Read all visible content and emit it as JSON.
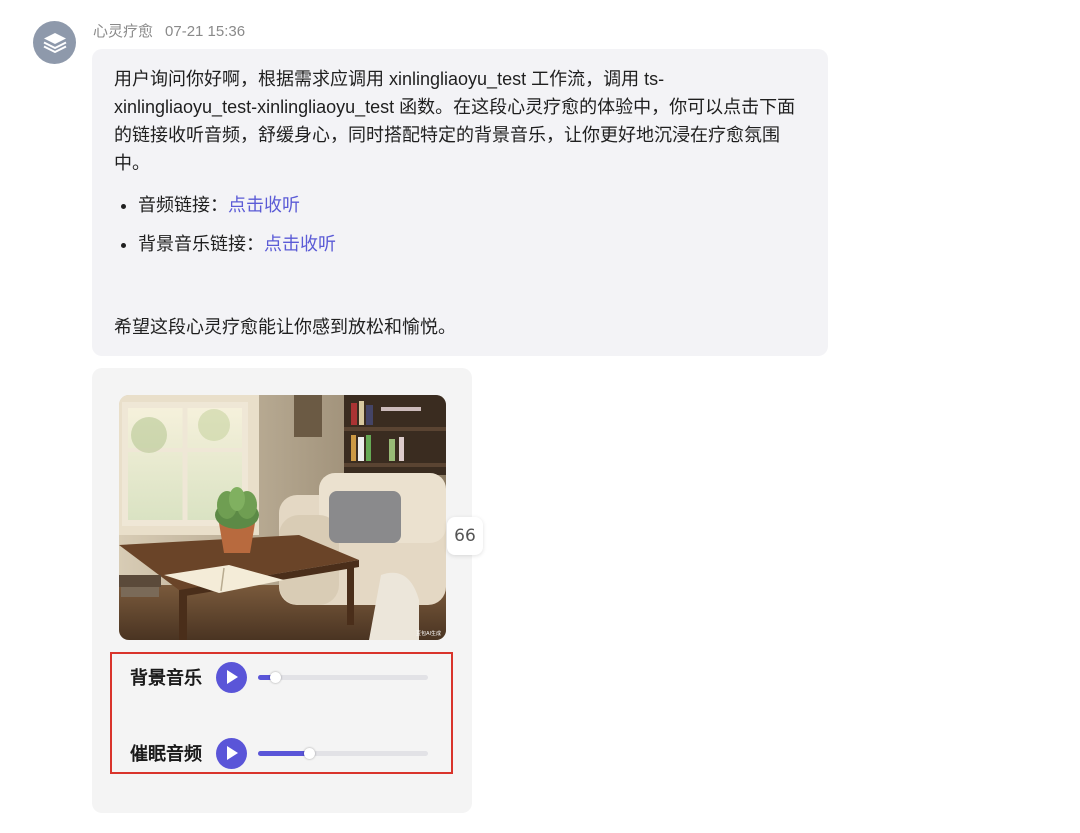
{
  "message": {
    "sender": "心灵疗愈",
    "timestamp": "07-21 15:36",
    "intro": "用户询问你好啊，根据需求应调用 xinlingliaoyu_test 工作流，调用 ts-xinlingliaoyu_test-xinlingliaoyu_test 函数。在这段心灵疗愈的体验中，你可以点击下面的链接收听音频，舒缓身心，同时搭配特定的背景音乐，让你更好地沉浸在疗愈氛围中。",
    "bullets": [
      {
        "label": "音频链接：",
        "link": "点击收听"
      },
      {
        "label": "背景音乐链接：",
        "link": "点击收听"
      }
    ],
    "closing": "希望这段心灵疗愈能让你感到放松和愉悦。"
  },
  "card": {
    "image_icon": "cozy-room-photo",
    "watermark": "豆包AI生成",
    "quote_icon": "66",
    "tracks": [
      {
        "name": "背景音乐",
        "progress": 0.1
      },
      {
        "name": "催眠音频",
        "progress": 0.3
      }
    ]
  },
  "colors": {
    "accent": "#5a55d8",
    "link": "#5b5bd6",
    "highlight_border": "#d9342b",
    "bubble_bg": "#f3f3f6"
  }
}
